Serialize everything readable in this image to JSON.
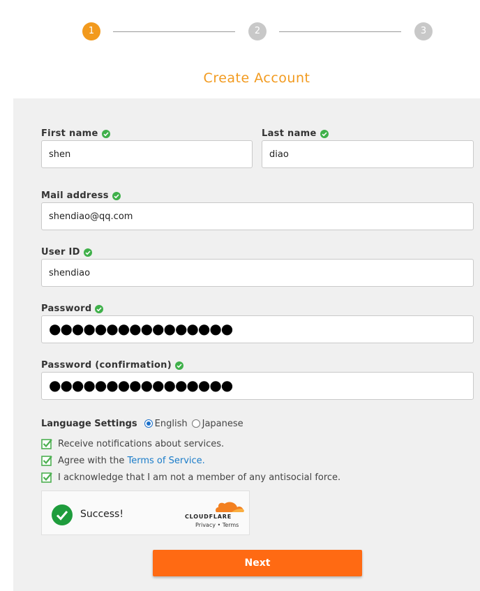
{
  "stepper": {
    "steps": [
      {
        "number": "1",
        "color": "#f29a1e"
      },
      {
        "number": "2",
        "color": "#c8c8c8"
      },
      {
        "number": "3",
        "color": "#c8c8c8"
      }
    ]
  },
  "title": {
    "text": "Create Account",
    "color": "#f29a1e"
  },
  "form": {
    "first_name": {
      "label": "First name",
      "value": "shen"
    },
    "last_name": {
      "label": "Last name",
      "value": "diao"
    },
    "mail": {
      "label": "Mail address",
      "value": "shendiao@qq.com"
    },
    "user_id": {
      "label": "User ID",
      "value": "shendiao"
    },
    "password": {
      "label": "Password",
      "masked": "●●●●●●●●●●●●●●●●"
    },
    "password_confirm": {
      "label": "Password (confirmation)",
      "masked": "●●●●●●●●●●●●●●●●"
    },
    "valid_icon": "check-circle-icon",
    "valid_color": "#3fb04a"
  },
  "language": {
    "label": "Language Settings",
    "options": [
      {
        "label": "English",
        "selected": true
      },
      {
        "label": "Japanese",
        "selected": false
      }
    ]
  },
  "checkboxes": [
    {
      "text": "Receive notifications about services.",
      "checked": true
    },
    {
      "text_before": "Agree with the ",
      "link": "Terms of Service",
      "text_after": ".",
      "checked": true
    },
    {
      "text": "I acknowledge that I am not a member of any antisocial force.",
      "checked": true
    }
  ],
  "captcha": {
    "status": "Success!",
    "brand": "CLOUDFLARE",
    "privacy": "Privacy",
    "separator": "•",
    "terms": "Terms",
    "success_color": "#1e9c3c",
    "brand_color": "#f38020"
  },
  "next_button": {
    "label": "Next",
    "color": "#ff6a13"
  }
}
